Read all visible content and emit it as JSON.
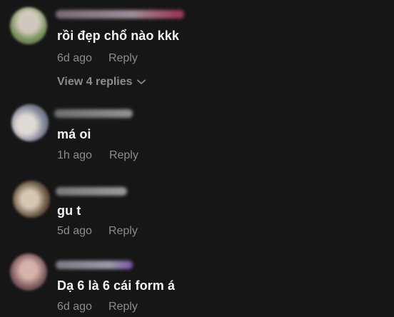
{
  "comments": [
    {
      "text": "rồi đẹp chổ nào kkk",
      "timestamp": "6d ago",
      "reply_label": "Reply",
      "view_replies_label": "View 4 replies",
      "avatar_colors": [
        "#6f8a58",
        "#c9c2b6"
      ],
      "username_color": "#9a8a95"
    },
    {
      "text": "má oi",
      "timestamp": "1h ago",
      "reply_label": "Reply",
      "avatar_colors": [
        "#6d7487",
        "#d7d1c9"
      ],
      "username_color": "#8a8a8a"
    },
    {
      "text": "gu t",
      "timestamp": "5d ago",
      "reply_label": "Reply",
      "avatar_colors": [
        "#5a4a3a",
        "#c8b8a2"
      ],
      "username_color": "#8d8f90"
    },
    {
      "text": "Dạ 6 là 6 cái form á",
      "timestamp": "6d ago",
      "reply_label": "Reply",
      "avatar_colors": [
        "#7a5a5a",
        "#cfa9a1"
      ],
      "username_color": "#8e8e9a"
    }
  ]
}
